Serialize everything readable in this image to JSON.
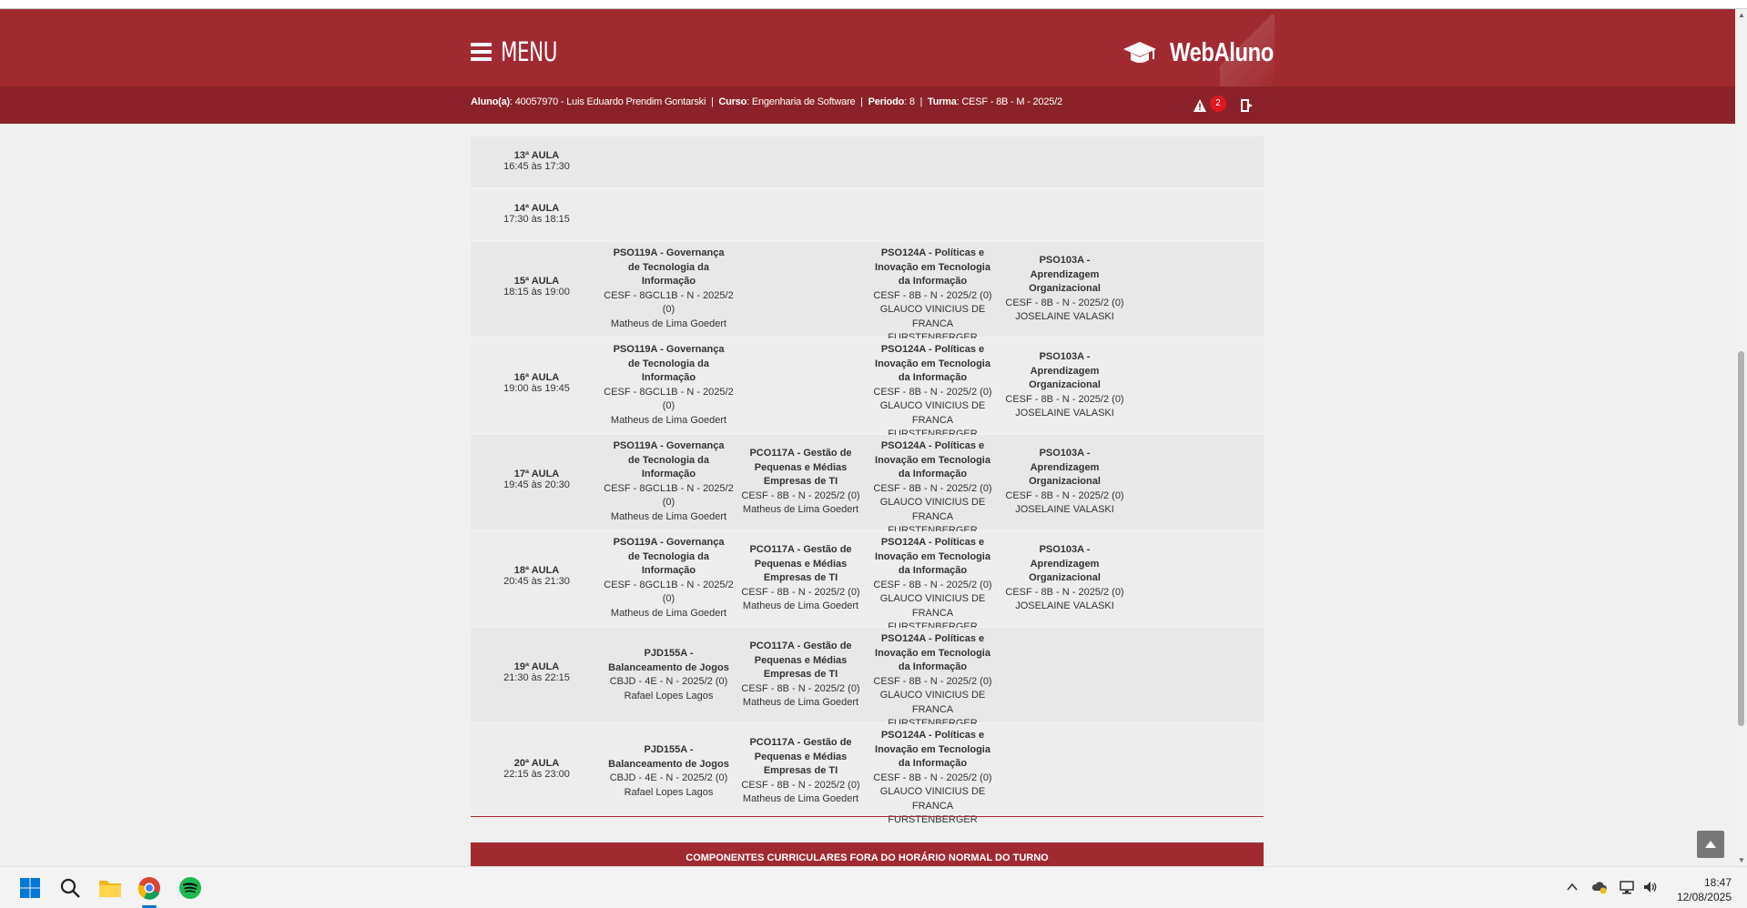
{
  "header": {
    "menu_label": "MENU",
    "brand": "WebAluno"
  },
  "student": {
    "aluno_label": "Aluno(a)",
    "aluno_value": ": 40057970 - Luis Eduardo Prendim Gontarski",
    "curso_label": "Curso",
    "curso_value": ": Engenharia de Software",
    "periodo_label": "Periodo",
    "periodo_value": ": 8",
    "turma_label": "Turma",
    "turma_value": ": CESF - 8B - M - 2025/2",
    "separator": "|",
    "alerts_count": "2"
  },
  "schedule": {
    "rows": [
      {
        "slot": "13ª AULA",
        "time": "16:45 às 17:30"
      },
      {
        "slot": "14ª AULA",
        "time": "17:30 às 18:15"
      },
      {
        "slot": "15ª AULA",
        "time": "18:15 às 19:00"
      },
      {
        "slot": "16ª AULA",
        "time": "19:00 às 19:45"
      },
      {
        "slot": "17ª AULA",
        "time": "19:45 às 20:30"
      },
      {
        "slot": "18ª AULA",
        "time": "20:45 às 21:30"
      },
      {
        "slot": "19ª AULA",
        "time": "21:30 às 22:15"
      },
      {
        "slot": "20ª AULA",
        "time": "22:15 às 23:00"
      }
    ],
    "courses": {
      "pso119": {
        "title_1": "PSO119A - Governança",
        "title_2": "de Tecnologia da",
        "title_3": "Informação",
        "class_1": "CESF - 8GCL1B - N - 2025/2",
        "class_2": "(0)",
        "teacher": "Matheus de Lima Goedert"
      },
      "pco117": {
        "title_1": "PCO117A - Gestão de",
        "title_2": "Pequenas e Médias",
        "title_3": "Empresas de TI",
        "class_1": "CESF - 8B - N - 2025/2 (0)",
        "teacher": "Matheus de Lima Goedert"
      },
      "pso124": {
        "title_1": "PSO124A - Políticas e",
        "title_2": "Inovação em Tecnologia",
        "title_3": "da Informação",
        "class_1": "CESF - 8B - N - 2025/2 (0)",
        "teacher_1": "GLAUCO VINICIUS DE",
        "teacher_2": "FRANCA FURSTENBERGER"
      },
      "pso103": {
        "title_1": "PSO103A -",
        "title_2": "Aprendizagem",
        "title_3": "Organizacional",
        "class_1": "CESF - 8B - N - 2025/2 (0)",
        "teacher": "JOSELAINE VALASKI"
      },
      "pjd155": {
        "title_1": "PJD155A -",
        "title_2": "Balanceamento de Jogos",
        "class_1": "CBJD - 4E - N - 2025/2 (0)",
        "teacher": "Rafael Lopes Lagos"
      }
    }
  },
  "footer_bar": "COMPONENTES CURRICULARES FORA DO HORÁRIO NORMAL DO TURNO",
  "taskbar": {
    "time": "18:47",
    "date": "12/08/2025"
  }
}
